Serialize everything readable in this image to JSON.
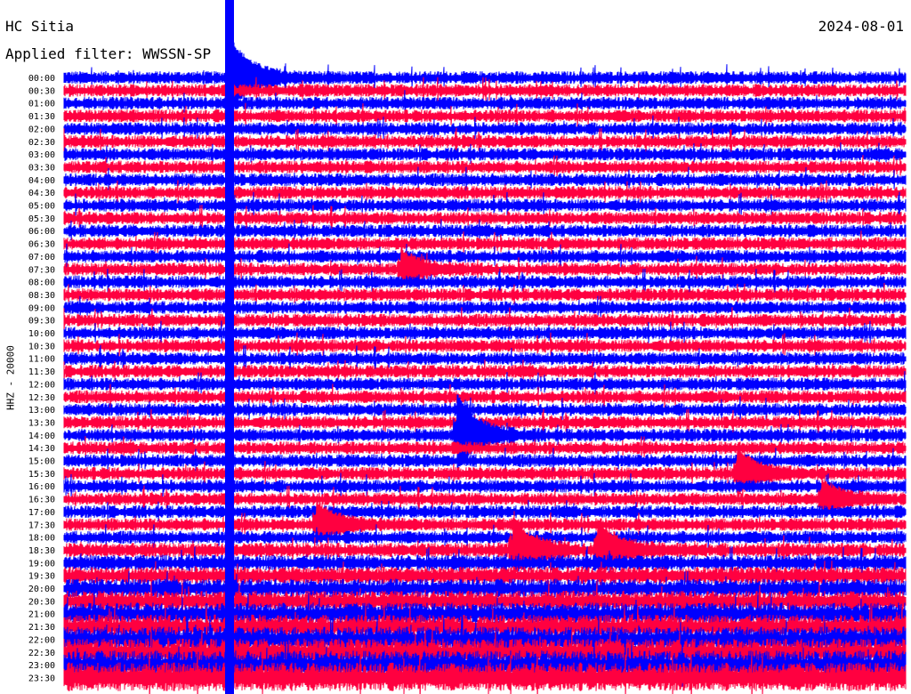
{
  "header": {
    "station": "HC Sitia",
    "date": "2024-08-01",
    "filter_label": "Applied filter: WWSSN-SP"
  },
  "chart_data": {
    "type": "line",
    "title": "HC Sitia",
    "subtitle": "Applied filter: WWSSN-SP",
    "ylabel": "HHZ - 20000",
    "row_labels": [
      "00:00",
      "00:30",
      "01:00",
      "01:30",
      "02:00",
      "02:30",
      "03:00",
      "03:30",
      "04:00",
      "04:30",
      "05:00",
      "05:30",
      "06:00",
      "06:30",
      "07:00",
      "07:30",
      "08:00",
      "08:30",
      "09:00",
      "09:30",
      "10:00",
      "10:30",
      "11:00",
      "11:30",
      "12:00",
      "12:30",
      "13:00",
      "13:30",
      "14:00",
      "14:30",
      "15:00",
      "15:30",
      "16:00",
      "16:30",
      "17:00",
      "17:30",
      "18:00",
      "18:30",
      "19:00",
      "19:30",
      "20:00",
      "20:30",
      "21:00",
      "21:30",
      "22:00",
      "22:30",
      "23:00",
      "23:30"
    ],
    "row_minutes": 30,
    "colors": [
      "#0000ff",
      "#ff0040"
    ],
    "amplitude_growth_after_row": 36,
    "events": [
      {
        "row": 0,
        "minute": 6,
        "color": "#ff0040",
        "strength": 1.0
      },
      {
        "row": 15,
        "minute": 12,
        "color": "#0000ff",
        "strength": 0.5
      },
      {
        "row": 28,
        "minute": 14,
        "color": "#0000ff",
        "strength": 0.55
      },
      {
        "row": 28,
        "minute": 14,
        "color": "#ff0040",
        "strength": 0.6
      },
      {
        "row": 31,
        "minute": 24,
        "color": "#ff0040",
        "strength": 0.7
      },
      {
        "row": 33,
        "minute": 27,
        "color": "#0000ff",
        "strength": 0.5
      },
      {
        "row": 35,
        "minute": 9,
        "color": "#0000ff",
        "strength": 0.6
      },
      {
        "row": 37,
        "minute": 16,
        "color": "#ff0040",
        "strength": 0.85
      },
      {
        "row": 37,
        "minute": 19,
        "color": "#ff0040",
        "strength": 0.85
      }
    ],
    "artifact": {
      "minute": 5.9,
      "color": "#0000ff"
    }
  }
}
